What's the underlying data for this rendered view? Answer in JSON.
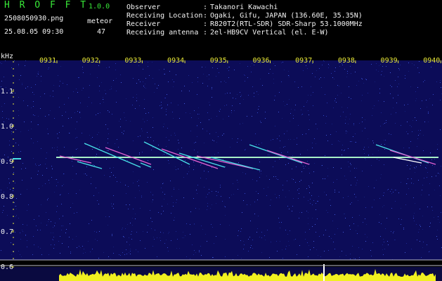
{
  "header": {
    "app_title": "H R O F F T",
    "version": "1.0.0",
    "filename": "2508050930.png",
    "meteor_label": "meteor",
    "datetime": "25.08.05 09:30",
    "meteor_count": "47"
  },
  "info": [
    {
      "label": "Observer",
      "colon": ":",
      "value": "Takanori Kawachi"
    },
    {
      "label": "Receiving Location",
      "colon": ":",
      "value": "Ogaki, Gifu, JAPAN (136.60E, 35.35N)"
    },
    {
      "label": "Receiver",
      "colon": ":",
      "value": "R820T2(RTL-SDR) SDR-Sharp 53.1000MHz"
    },
    {
      "label": "Receiving antenna",
      "colon": ":",
      "value": "2el-HB9CV Vertical (el. E-W)"
    }
  ],
  "axis": {
    "unit": "kHz",
    "y_ticks": [
      "1.1",
      "1.0",
      "0.9",
      "0.8",
      "0.7",
      "0.6"
    ],
    "x_ticks": [
      "0931",
      "0932",
      "0933",
      "0934",
      "0935",
      "0936",
      "0937",
      "0938",
      "0939",
      "0940"
    ]
  },
  "colors": {
    "background": "#000000",
    "noise_dark": "#0c0c58",
    "noise_bright": "#2a40b8",
    "carrier": "#a8f0c8",
    "echo_cyan": "#48e0e8",
    "echo_magenta": "#e060d0",
    "level_yellow": "#f0f020",
    "tick_yellow": "#e8e838",
    "divider": "#b8b8c8"
  }
}
